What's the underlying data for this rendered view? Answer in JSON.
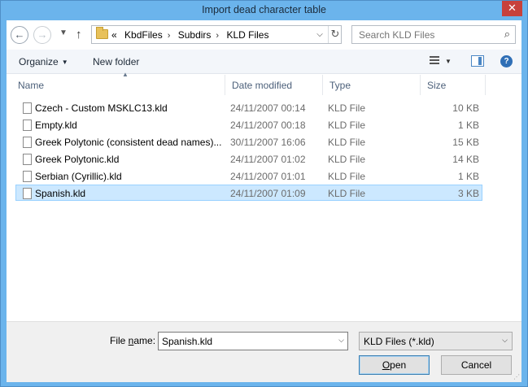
{
  "window": {
    "title": "Import dead character table",
    "close_glyph": "✕"
  },
  "nav": {
    "back_icon": "back-arrow-icon",
    "forward_icon": "forward-arrow-icon",
    "up_icon": "up-arrow-icon",
    "breadcrumb_prefix": "«",
    "breadcrumbs": [
      "KbdFiles",
      "Subdirs",
      "KLD Files"
    ],
    "search_placeholder": "Search KLD Files"
  },
  "toolbar": {
    "organize_label": "Organize",
    "new_folder_label": "New folder"
  },
  "columns": {
    "name": "Name",
    "date": "Date modified",
    "type": "Type",
    "size": "Size"
  },
  "files": [
    {
      "name": "Czech - Custom MSKLC13.kld",
      "date": "24/11/2007 00:14",
      "type": "KLD File",
      "size": "10 KB"
    },
    {
      "name": "Empty.kld",
      "date": "24/11/2007 00:18",
      "type": "KLD File",
      "size": "1 KB"
    },
    {
      "name": "Greek Polytonic (consistent dead names)...",
      "date": "30/11/2007 16:06",
      "type": "KLD File",
      "size": "15 KB"
    },
    {
      "name": "Greek Polytonic.kld",
      "date": "24/11/2007 01:02",
      "type": "KLD File",
      "size": "14 KB"
    },
    {
      "name": "Serbian (Cyrillic).kld",
      "date": "24/11/2007 01:01",
      "type": "KLD File",
      "size": "1 KB"
    },
    {
      "name": "Spanish.kld",
      "date": "24/11/2007 01:09",
      "type": "KLD File",
      "size": "3 KB",
      "selected": true
    }
  ],
  "footer": {
    "file_name_label_pre": "File ",
    "file_name_label_ul": "n",
    "file_name_label_post": "ame:",
    "file_name_value": "Spanish.kld",
    "filter_value": "KLD Files (*.kld)",
    "open_label_ul": "O",
    "open_label_rest": "pen",
    "cancel_label": "Cancel"
  }
}
